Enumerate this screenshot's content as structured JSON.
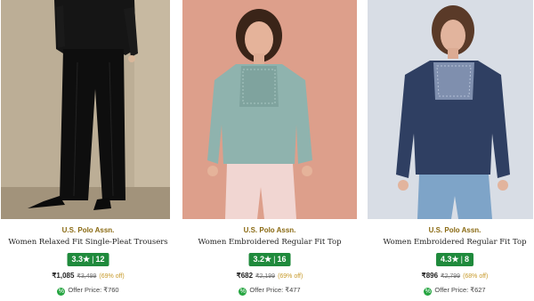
{
  "products": [
    {
      "brand": "U.S. Polo Assn.",
      "name": "Women Relaxed Fit Single-Pleat Trousers",
      "rating": "3.3",
      "rating_count": "12",
      "price": "₹1,085",
      "mrp": "₹3,499",
      "discount": "(69% off)",
      "offer_label": "Offer Price:",
      "offer_price": "₹760",
      "image_icon": "model-photo-black-trousers",
      "colors": {
        "rating_bg": "#1f8a3c",
        "brand": "#8a6a13"
      }
    },
    {
      "brand": "U.S. Polo Assn.",
      "name": "Women Embroidered Regular Fit Top",
      "rating": "3.2",
      "rating_count": "16",
      "price": "₹682",
      "mrp": "₹2,199",
      "discount": "(69% off)",
      "offer_label": "Offer Price:",
      "offer_price": "₹477",
      "image_icon": "model-photo-sage-top",
      "colors": {
        "rating_bg": "#1f8a3c",
        "brand": "#8a6a13"
      }
    },
    {
      "brand": "U.S. Polo Assn.",
      "name": "Women Embroidered Regular Fit Top",
      "rating": "4.3",
      "rating_count": "8",
      "price": "₹896",
      "mrp": "₹2,799",
      "discount": "(68% off)",
      "offer_label": "Offer Price:",
      "offer_price": "₹627",
      "image_icon": "model-photo-navy-top",
      "colors": {
        "rating_bg": "#1f8a3c",
        "brand": "#8a6a13"
      }
    }
  ]
}
